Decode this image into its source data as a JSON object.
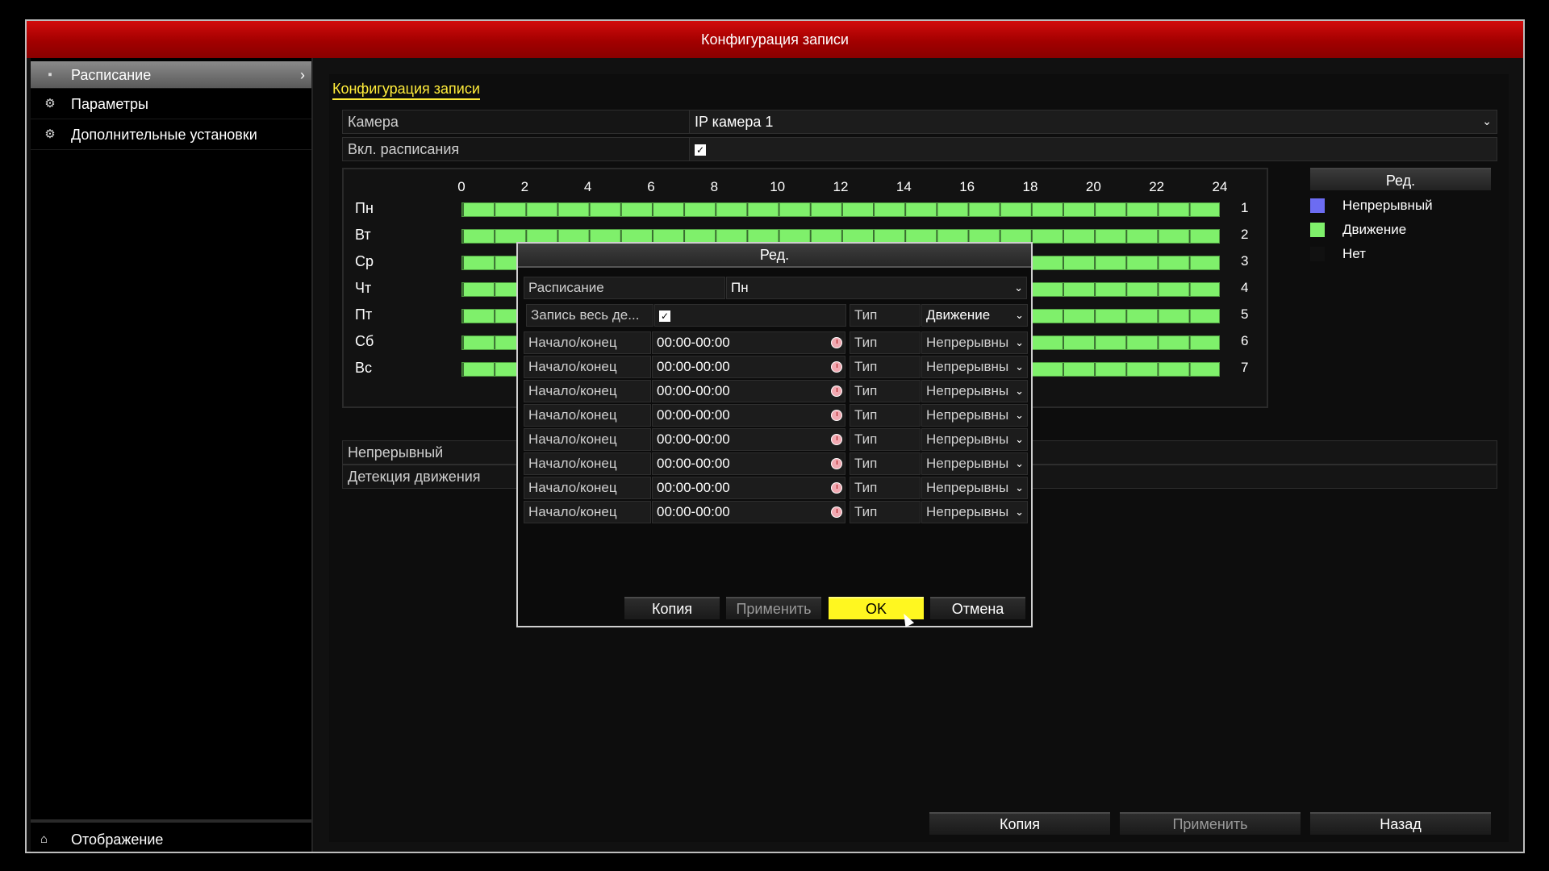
{
  "window": {
    "title": "Конфигурация записи"
  },
  "sidebar": {
    "items": [
      {
        "label": "Расписание",
        "icon": "schedule-icon"
      },
      {
        "label": "Параметры",
        "icon": "gear-icon"
      },
      {
        "label": "Дополнительные установки",
        "icon": "gears-icon"
      }
    ],
    "bottom": {
      "label": "Отображение",
      "icon": "home-icon"
    }
  },
  "main": {
    "section_title": "Конфигурация записи",
    "camera": {
      "label": "Камера",
      "value": "IP камера 1"
    },
    "schedule_enable": {
      "label": "Вкл. расписания",
      "checked": true
    },
    "modes": [
      "Непрерывный",
      "Детекция движения"
    ]
  },
  "timeline": {
    "hours": [
      "0",
      "2",
      "4",
      "6",
      "8",
      "10",
      "12",
      "14",
      "16",
      "18",
      "20",
      "22",
      "24"
    ],
    "days": [
      "Пн",
      "Вт",
      "Ср",
      "Чт",
      "Пт",
      "Сб",
      "Вс"
    ],
    "day_numbers": [
      "1",
      "2",
      "3",
      "4",
      "5",
      "6",
      "7"
    ],
    "bar_color": "#7ff06b"
  },
  "legend": {
    "header": "Ред.",
    "items": [
      {
        "label": "Непрерывный",
        "color": "#6c6cf2"
      },
      {
        "label": "Движение",
        "color": "#7ff06b"
      },
      {
        "label": "Нет",
        "color": "#111111"
      }
    ]
  },
  "footer_buttons": {
    "copy": "Копия",
    "apply": "Применить",
    "back": "Назад"
  },
  "dialog": {
    "title": "Ред.",
    "schedule": {
      "label": "Расписание",
      "value": "Пн"
    },
    "all_day": {
      "label": "Запись весь де...",
      "checked": true,
      "type_label": "Тип",
      "type_value": "Движение"
    },
    "periods": [
      {
        "label": "Начало/конец",
        "time": "00:00-00:00",
        "type_label": "Тип",
        "type_value": "Непрерывны"
      },
      {
        "label": "Начало/конец",
        "time": "00:00-00:00",
        "type_label": "Тип",
        "type_value": "Непрерывны"
      },
      {
        "label": "Начало/конец",
        "time": "00:00-00:00",
        "type_label": "Тип",
        "type_value": "Непрерывны"
      },
      {
        "label": "Начало/конец",
        "time": "00:00-00:00",
        "type_label": "Тип",
        "type_value": "Непрерывны"
      },
      {
        "label": "Начало/конец",
        "time": "00:00-00:00",
        "type_label": "Тип",
        "type_value": "Непрерывны"
      },
      {
        "label": "Начало/конец",
        "time": "00:00-00:00",
        "type_label": "Тип",
        "type_value": "Непрерывны"
      },
      {
        "label": "Начало/конец",
        "time": "00:00-00:00",
        "type_label": "Тип",
        "type_value": "Непрерывны"
      },
      {
        "label": "Начало/конец",
        "time": "00:00-00:00",
        "type_label": "Тип",
        "type_value": "Непрерывны"
      }
    ],
    "buttons": {
      "copy": "Копия",
      "apply": "Применить",
      "ok": "OK",
      "cancel": "Отмена"
    }
  }
}
